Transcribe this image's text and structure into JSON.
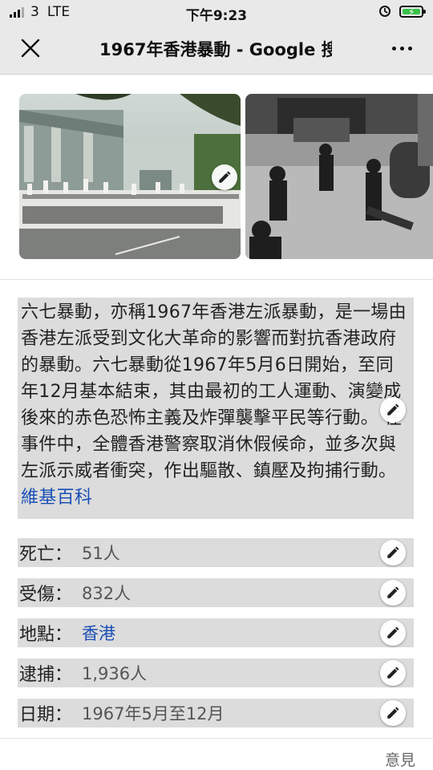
{
  "status_bar": {
    "signal": "3",
    "network": "LTE",
    "time": "下午9:23"
  },
  "header": {
    "title": "1967年香港暴動 - Google 搜"
  },
  "summary": {
    "text": "六七暴動，亦稱1967年香港左派暴動，是一場由香港左派受到文化大革命的影響而對抗香港政府的暴動。六七暴動從1967年5月6日開始，至同年12月基本結束，其由最初的工人運動、演變成後來的赤色恐怖主義及炸彈襲擊平民等行動。 在事件中，全體香港警察取消休假候命，並多次與左派示威者衝突，作出驅散、鎮壓及拘捕行動。",
    "source": "維基百科"
  },
  "facts": [
    {
      "label": "死亡：",
      "value": "51人"
    },
    {
      "label": "受傷：",
      "value": "832人"
    },
    {
      "label": "地點：",
      "value": "香港"
    },
    {
      "label": "逮捕：",
      "value": "1,936人"
    },
    {
      "label": "日期：",
      "value": "1967年5月至12月"
    }
  ],
  "footer": {
    "feedback": "意見"
  },
  "colors": {
    "link": "#1a4fb5",
    "highlight": "#dcdcdc",
    "chrome": "#e9e9ea"
  },
  "icons": [
    "close-icon",
    "more-icon",
    "pencil-icon",
    "battery-icon",
    "signal-icon",
    "do-not-disturb-icon"
  ]
}
